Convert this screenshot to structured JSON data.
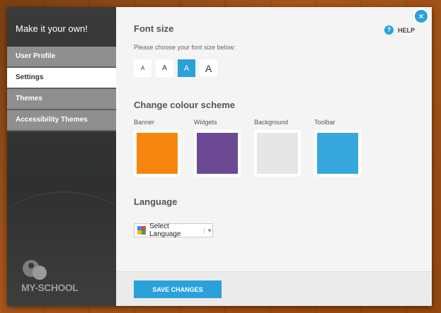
{
  "sidebar": {
    "title": "Make it your own!",
    "items": [
      {
        "label": "User Profile",
        "active": false
      },
      {
        "label": "Settings",
        "active": true
      },
      {
        "label": "Themes",
        "active": false
      },
      {
        "label": "Accessibility Themes",
        "active": false
      }
    ],
    "logo_text": "MY-SCHOOL"
  },
  "help_label": "HELP",
  "font_size": {
    "heading": "Font size",
    "instruction": "Please choose your font size below:",
    "options": [
      "A",
      "A",
      "A",
      "A"
    ],
    "selected_index": 2
  },
  "colour_scheme": {
    "heading": "Change colour scheme",
    "items": [
      {
        "label": "Banner",
        "color": "#f7860f"
      },
      {
        "label": "Widgets",
        "color": "#6b4a93"
      },
      {
        "label": "Background",
        "color": "#e6e6e6"
      },
      {
        "label": "Toolbar",
        "color": "#36a7dd"
      }
    ]
  },
  "language": {
    "heading": "Language",
    "select_value": "Select Language"
  },
  "footer": {
    "save_label": "SAVE CHANGES"
  },
  "close_icon": "×",
  "accent_color": "#2aa1db"
}
